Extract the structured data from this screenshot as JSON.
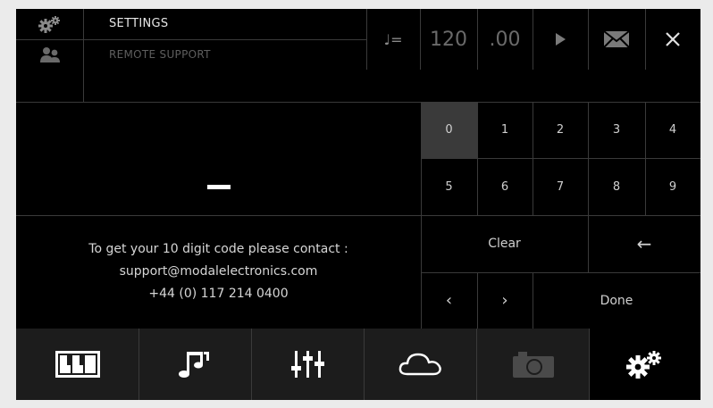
{
  "header": {
    "title": "SETTINGS",
    "subtitle": "REMOTE SUPPORT",
    "tempo_symbol": "♩=",
    "tempo_integer": "120",
    "tempo_decimal": ".00"
  },
  "code_display": {
    "value": "-"
  },
  "keypad": {
    "digits": [
      "0",
      "1",
      "2",
      "3",
      "4",
      "5",
      "6",
      "7",
      "8",
      "9"
    ],
    "selected_digit": "0",
    "clear_label": "Clear",
    "backspace_label": "←",
    "prev_label": "‹",
    "next_label": "›",
    "done_label": "Done"
  },
  "info": {
    "line1": "To get your 10 digit code please contact :",
    "line2": "support@modalelectronics.com",
    "line3": "+44 (0) 117 214 0400"
  },
  "tabs": [
    {
      "icon": "piano-keys-icon",
      "active": false
    },
    {
      "icon": "music-notes-icon",
      "active": false
    },
    {
      "icon": "mixer-sliders-icon",
      "active": false
    },
    {
      "icon": "cloud-icon",
      "active": false
    },
    {
      "icon": "camera-icon",
      "active": false,
      "disabled": true
    },
    {
      "icon": "settings-gears-icon",
      "active": true
    }
  ]
}
